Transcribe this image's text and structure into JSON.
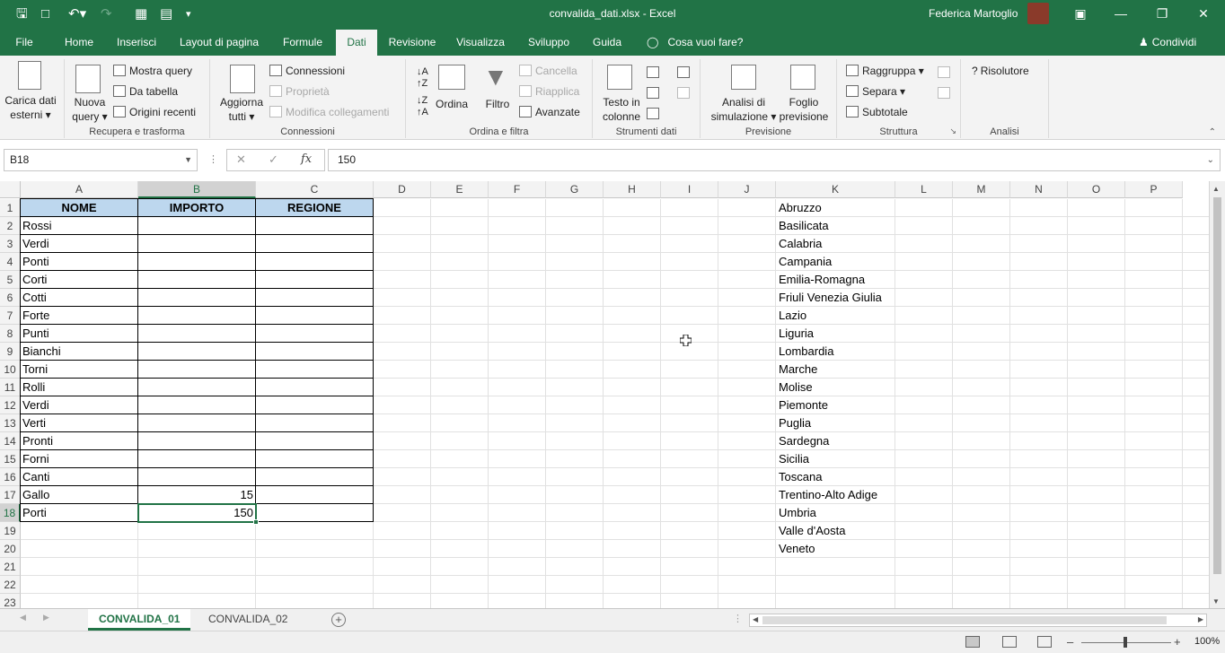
{
  "app": {
    "file_title": "convalida_dati.xlsx",
    "separator": "-",
    "app_name": "Excel",
    "user_name": "Federica Martoglio"
  },
  "tabs": [
    "File",
    "Home",
    "Inserisci",
    "Layout di pagina",
    "Formule",
    "Dati",
    "Revisione",
    "Visualizza",
    "Sviluppo",
    "Guida"
  ],
  "active_tab": "Dati",
  "tell_me": "Cosa vuoi fare?",
  "share": "Condividi",
  "ribbon": {
    "carica_dati": "Carica dati",
    "carica_dati2": "esterni",
    "nuova_query": "Nuova",
    "nuova_query2": "query",
    "mostra_query": "Mostra query",
    "da_tabella": "Da tabella",
    "origini_recenti": "Origini recenti",
    "group1": "Recupera e trasforma",
    "aggiorna": "Aggiorna",
    "aggiorna2": "tutti",
    "connessioni": "Connessioni",
    "proprieta": "Proprietà",
    "modifica_collegamenti": "Modifica collegamenti",
    "group2": "Connessioni",
    "ordina": "Ordina",
    "filtro": "Filtro",
    "cancella": "Cancella",
    "riapplica": "Riapplica",
    "avanzate": "Avanzate",
    "group3": "Ordina e filtra",
    "testo_colonne": "Testo in",
    "testo_colonne2": "colonne",
    "group4": "Strumenti dati",
    "analisi": "Analisi di",
    "analisi2": "simulazione",
    "foglio": "Foglio",
    "foglio2": "previsione",
    "group5": "Previsione",
    "raggruppa": "Raggruppa",
    "separa": "Separa",
    "subtotale": "Subtotale",
    "group6": "Struttura",
    "risolutore": "Risolutore",
    "group7": "Analisi"
  },
  "formula_bar": {
    "name_box": "B18",
    "fx": "fx",
    "formula": "150"
  },
  "columns": [
    "A",
    "B",
    "C",
    "D",
    "E",
    "F",
    "G",
    "H",
    "I",
    "J",
    "K",
    "L",
    "M",
    "N",
    "O",
    "P"
  ],
  "rows": [
    "1",
    "2",
    "3",
    "4",
    "5",
    "6",
    "7",
    "8",
    "9",
    "10",
    "11",
    "12",
    "13",
    "14",
    "15",
    "16",
    "17",
    "18",
    "19",
    "20",
    "21",
    "22",
    "23"
  ],
  "table": {
    "headers": [
      "NOME",
      "IMPORTO",
      "REGIONE"
    ],
    "names": [
      "Rossi",
      "Verdi",
      "Ponti",
      "Corti",
      "Cotti",
      "Forte",
      "Punti",
      "Bianchi",
      "Torni",
      "Rolli",
      "Verdi",
      "Verti",
      "Pronti",
      "Forni",
      "Canti",
      "Gallo",
      "Porti"
    ],
    "importi": [
      "",
      "",
      "",
      "",
      "",
      "",
      "",
      "",
      "",
      "",
      "",
      "",
      "",
      "",
      "",
      "15",
      "150"
    ],
    "regioni": [
      "",
      "",
      "",
      "",
      "",
      "",
      "",
      "",
      "",
      "",
      "",
      "",
      "",
      "",
      "",
      "",
      ""
    ]
  },
  "regions_list": [
    "Abruzzo",
    "Basilicata",
    "Calabria",
    "Campania",
    "Emilia-Romagna",
    "Friuli Venezia Giulia",
    "Lazio",
    "Liguria",
    "Lombardia",
    "Marche",
    "Molise",
    "Piemonte",
    "Puglia",
    "Sardegna",
    "Sicilia",
    "Toscana",
    "Trentino-Alto Adige",
    "Umbria",
    "Valle d'Aosta",
    "Veneto"
  ],
  "sheets": [
    "CONVALIDA_01",
    "CONVALIDA_02"
  ],
  "active_sheet": "CONVALIDA_01",
  "status": {
    "zoom": "100%"
  },
  "colors": {
    "excel_green": "#217346",
    "header_fill": "#bdd7ee"
  }
}
